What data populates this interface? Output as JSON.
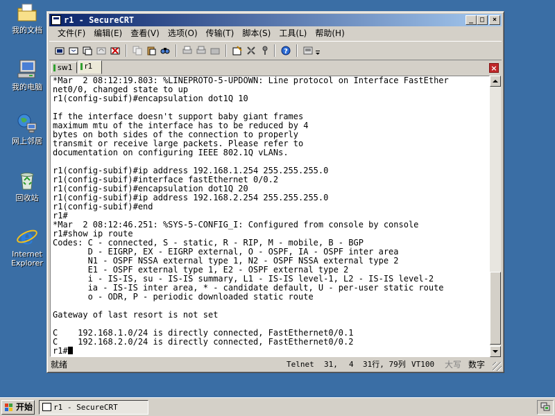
{
  "desktop": {
    "icons": [
      {
        "label": "我的文档",
        "icon": "my-documents-icon"
      },
      {
        "label": "我的电脑",
        "icon": "my-computer-icon"
      },
      {
        "label": "网上邻居",
        "icon": "network-places-icon"
      },
      {
        "label": "回收站",
        "icon": "recycle-bin-icon"
      },
      {
        "label": "Internet Explorer",
        "icon": "internet-explorer-icon"
      }
    ]
  },
  "window": {
    "title": "r1 - SecureCRT",
    "controls": {
      "minimize": "_",
      "maximize": "□",
      "close": "×"
    },
    "menu": [
      "文件(F)",
      "编辑(E)",
      "查看(V)",
      "选项(O)",
      "传输(T)",
      "脚本(S)",
      "工具(L)",
      "帮助(H)"
    ],
    "tabs": [
      {
        "label": "sw1",
        "active": false
      },
      {
        "label": "r1",
        "active": true
      }
    ],
    "tab_close": "×",
    "terminal_lines": [
      "*Mar  2 08:12:19.803: %LINEPROTO-5-UPDOWN: Line protocol on Interface FastEther",
      "net0/0, changed state to up",
      "r1(config-subif)#encapsulation dot1Q 10",
      "",
      "If the interface doesn't support baby giant frames",
      "maximum mtu of the interface has to be reduced by 4",
      "bytes on both sides of the connection to properly",
      "transmit or receive large packets. Please refer to",
      "documentation on configuring IEEE 802.1Q vLANs.",
      "",
      "r1(config-subif)#ip address 192.168.1.254 255.255.255.0",
      "r1(config-subif)#interface fastEthernet 0/0.2",
      "r1(config-subif)#encapsulation dot1Q 20",
      "r1(config-subif)#ip address 192.168.2.254 255.255.255.0",
      "r1(config-subif)#end",
      "r1#",
      "*Mar  2 08:12:46.251: %SYS-5-CONFIG_I: Configured from console by console",
      "r1#show ip route",
      "Codes: C - connected, S - static, R - RIP, M - mobile, B - BGP",
      "       D - EIGRP, EX - EIGRP external, O - OSPF, IA - OSPF inter area",
      "       N1 - OSPF NSSA external type 1, N2 - OSPF NSSA external type 2",
      "       E1 - OSPF external type 1, E2 - OSPF external type 2",
      "       i - IS-IS, su - IS-IS summary, L1 - IS-IS level-1, L2 - IS-IS level-2",
      "       ia - IS-IS inter area, * - candidate default, U - per-user static route",
      "       o - ODR, P - periodic downloaded static route",
      "",
      "Gateway of last resort is not set",
      "",
      "C    192.168.1.0/24 is directly connected, FastEthernet0/0.1",
      "C    192.168.2.0/24 is directly connected, FastEthernet0/0.2"
    ],
    "prompt": "r1#",
    "status": {
      "ready": "就绪",
      "protocol": "Telnet",
      "row": "31,",
      "col": "4",
      "rowcol": "31行, 79列",
      "emulation": "VT100",
      "caps": "大写",
      "num": "数字"
    }
  },
  "taskbar": {
    "start_label": "开始",
    "task_label": "r1 - SecureCRT"
  },
  "colors": {
    "desktop": "#3a6ea5",
    "title_start": "#0a246a",
    "title_end": "#a6caf0",
    "tab_stripe": "#2fa02f",
    "tab_close": "#c0282a"
  }
}
